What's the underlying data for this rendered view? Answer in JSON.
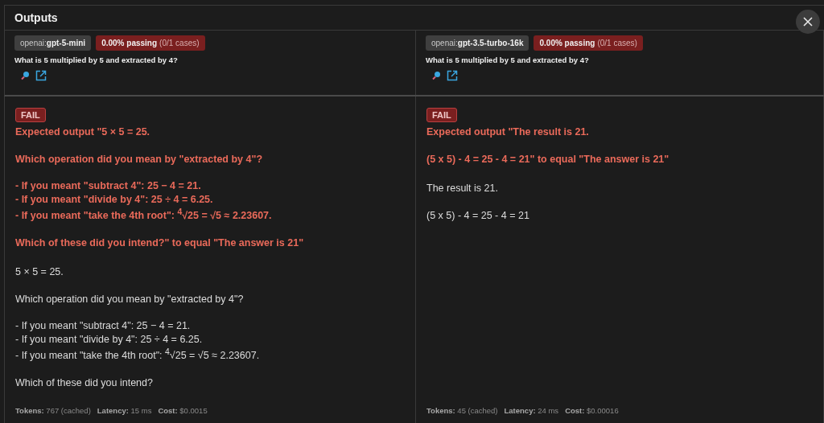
{
  "panel": {
    "title": "Outputs"
  },
  "columns": [
    {
      "provider": "openai:**gpt-5-mini**",
      "pass_rate": "0.00% passing",
      "cases": "(0/1 cases)",
      "question": "What is 5 multiplied by 5 and extracted by 4?",
      "result": {
        "kind": "fail",
        "label": "FAIL"
      },
      "expected": [
        "Expected output \"5 × 5 = 25.",
        "Which operation did you mean by \"extracted by 4\"?",
        "- If you meant \"subtract 4\": 25 − 4 = 21.\n- If you meant \"divide by 4\": 25 ÷ 4 = 6.25.\n- If you meant \"take the 4th root\": $^{4}$√25 = √5 ≈ 2.23607.",
        "Which of these did you intend?\" to equal \"The answer is 21\""
      ],
      "output": [
        "5 × 5 = 25.",
        "Which operation did you mean by \"extracted by 4\"?",
        "- If you meant \"subtract 4\": 25 − 4 = 21.\n- If you meant \"divide by 4\": 25 ÷ 4 = 6.25.\n- If you meant \"take the 4th root\": $^{4}$√25 = √5 ≈ 2.23607.",
        "Which of these did you intend?"
      ],
      "metrics": [
        "**Tokens:** 767 (cached)",
        "**Latency:** 15 ms",
        "**Cost:** $0.0015"
      ]
    },
    {
      "provider": "openai:**gpt-3.5-turbo-16k**",
      "pass_rate": "0.00% passing",
      "cases": "(0/1 cases)",
      "question": "What is 5 multiplied by 5 and extracted by 4?",
      "result": {
        "kind": "fail",
        "label": "FAIL"
      },
      "expected": [
        "Expected output \"The result is 21.",
        "(5 x 5) - 4 = 25 - 4 = 21\" to equal \"The answer is 21\""
      ],
      "output": [
        "The result is 21.",
        "(5 x 5) - 4 = 25 - 4 = 21"
      ],
      "metrics": [
        "**Tokens:** 45 (cached)",
        "**Latency:** 24 ms",
        "**Cost:** $0.00016"
      ]
    }
  ]
}
